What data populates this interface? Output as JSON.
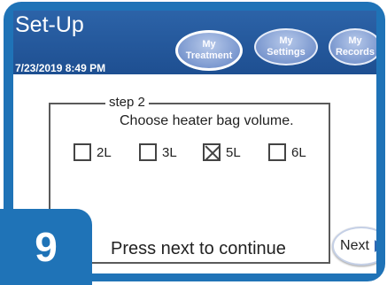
{
  "header": {
    "title": "Set-Up",
    "datetime": "7/23/2019   8:49 PM",
    "tabs": [
      {
        "label": "My\nTreatment"
      },
      {
        "label": "My\nSettings"
      },
      {
        "label": "My\nRecords"
      }
    ]
  },
  "step": {
    "legend": "step 2",
    "prompt": "Choose heater bag volume.",
    "options": [
      {
        "label": "2L",
        "checked": false
      },
      {
        "label": "3L",
        "checked": false
      },
      {
        "label": "5L",
        "checked": true
      },
      {
        "label": "6L",
        "checked": false
      }
    ]
  },
  "footer": {
    "instruction": "Press next to continue",
    "next_label": "Next"
  },
  "badge": {
    "number": "9"
  },
  "colors": {
    "frame": "#1f73b7",
    "header": "#2c63a8",
    "tab": "#7b98cf"
  }
}
